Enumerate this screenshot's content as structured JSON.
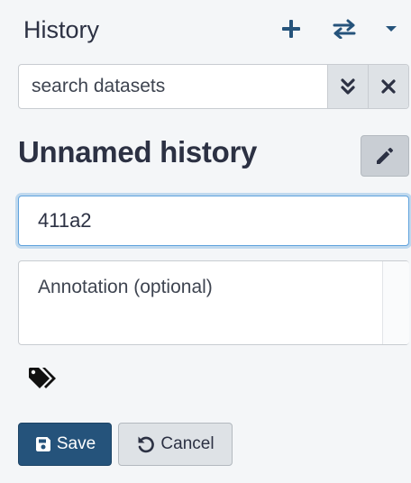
{
  "header": {
    "title": "History",
    "icons": [
      "plus-icon",
      "switch-icon",
      "caret-down-icon"
    ]
  },
  "search": {
    "placeholder": "search datasets",
    "value": "",
    "icons": [
      "double-chevron-down-icon",
      "close-icon"
    ]
  },
  "history": {
    "name": "Unnamed history",
    "edit_icon": "pencil-icon"
  },
  "editor": {
    "name_value": "411a2",
    "annotation_placeholder": "Annotation (optional)",
    "tags_icon": "tags-icon",
    "save_label": "Save",
    "save_icon": "floppy-disk-icon",
    "cancel_label": "Cancel",
    "cancel_icon": "undo-icon"
  },
  "colors": {
    "primary": "#25537b",
    "text": "#2c3143",
    "focus": "#5fa2dd",
    "background": "#f4f6f8"
  }
}
